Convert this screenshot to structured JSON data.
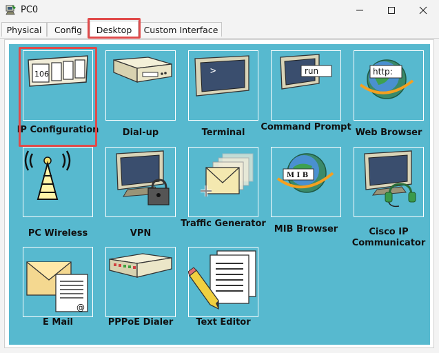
{
  "window": {
    "title": "PC0"
  },
  "tabs": [
    {
      "label": "Physical"
    },
    {
      "label": "Config"
    },
    {
      "label": "Desktop"
    },
    {
      "label": "Custom Interface"
    }
  ],
  "active_tab": "Desktop",
  "apps": [
    {
      "label": "IP Configuration",
      "icon": "ip-config-icon",
      "icon_text": "106"
    },
    {
      "label": "Dial-up",
      "icon": "modem-icon"
    },
    {
      "label": "Terminal",
      "icon": "terminal-icon",
      "icon_text": ">"
    },
    {
      "label": "Command Prompt",
      "icon": "command-prompt-icon",
      "icon_text": "run"
    },
    {
      "label": "Web Browser",
      "icon": "web-browser-icon",
      "icon_text": "http:"
    },
    {
      "label": "PC Wireless",
      "icon": "wireless-tower-icon"
    },
    {
      "label": "VPN",
      "icon": "vpn-lock-icon"
    },
    {
      "label": "Traffic Generator",
      "icon": "traffic-generator-icon"
    },
    {
      "label": "MIB Browser",
      "icon": "mib-browser-icon",
      "icon_text": "M I B"
    },
    {
      "label": "Cisco IP Communicator",
      "icon": "ip-communicator-icon"
    },
    {
      "label": "E Mail",
      "icon": "email-icon",
      "icon_text": "@"
    },
    {
      "label": "PPPoE Dialer",
      "icon": "pppoe-dialer-icon"
    },
    {
      "label": "Text Editor",
      "icon": "text-editor-icon"
    }
  ],
  "colors": {
    "desktop_bg": "#57b9cf",
    "highlight": "#e04a4a"
  }
}
